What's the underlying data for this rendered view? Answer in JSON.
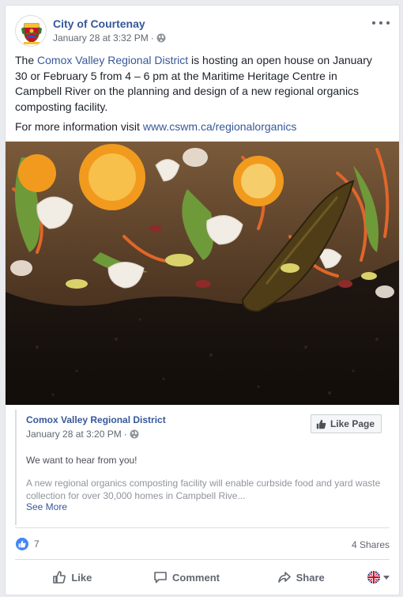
{
  "post": {
    "page_name": "City of Courtenay",
    "timestamp": "January 28 at 3:32 PM",
    "separator": "·",
    "text_prefix": "The ",
    "text_link": "Comox Valley Regional District",
    "text_rest": " is hosting an open house on January 30 or February 5 from 4 – 6 pm at the Maritime Heritage Centre in Campbell River on the planning and design of a new regional organics composting facility.",
    "more_info_prefix": "For more information visit ",
    "more_info_link": "www.cswm.ca/regionalorganics"
  },
  "shared": {
    "page_name": "Comox Valley Regional District",
    "timestamp": "January 28 at 3:20 PM",
    "separator": "·",
    "like_page_label": "Like Page",
    "headline": "We want to hear from you!",
    "body": "A new regional organics composting facility will enable curbside food and yard waste collection for over 30,000 homes in Campbell Rive...",
    "see_more": "See More"
  },
  "stats": {
    "reaction_count": "7",
    "shares": "4 Shares"
  },
  "actions": {
    "like": "Like",
    "comment": "Comment",
    "share": "Share"
  },
  "colors": {
    "link": "#365899",
    "like_blue": "#4287f5"
  }
}
